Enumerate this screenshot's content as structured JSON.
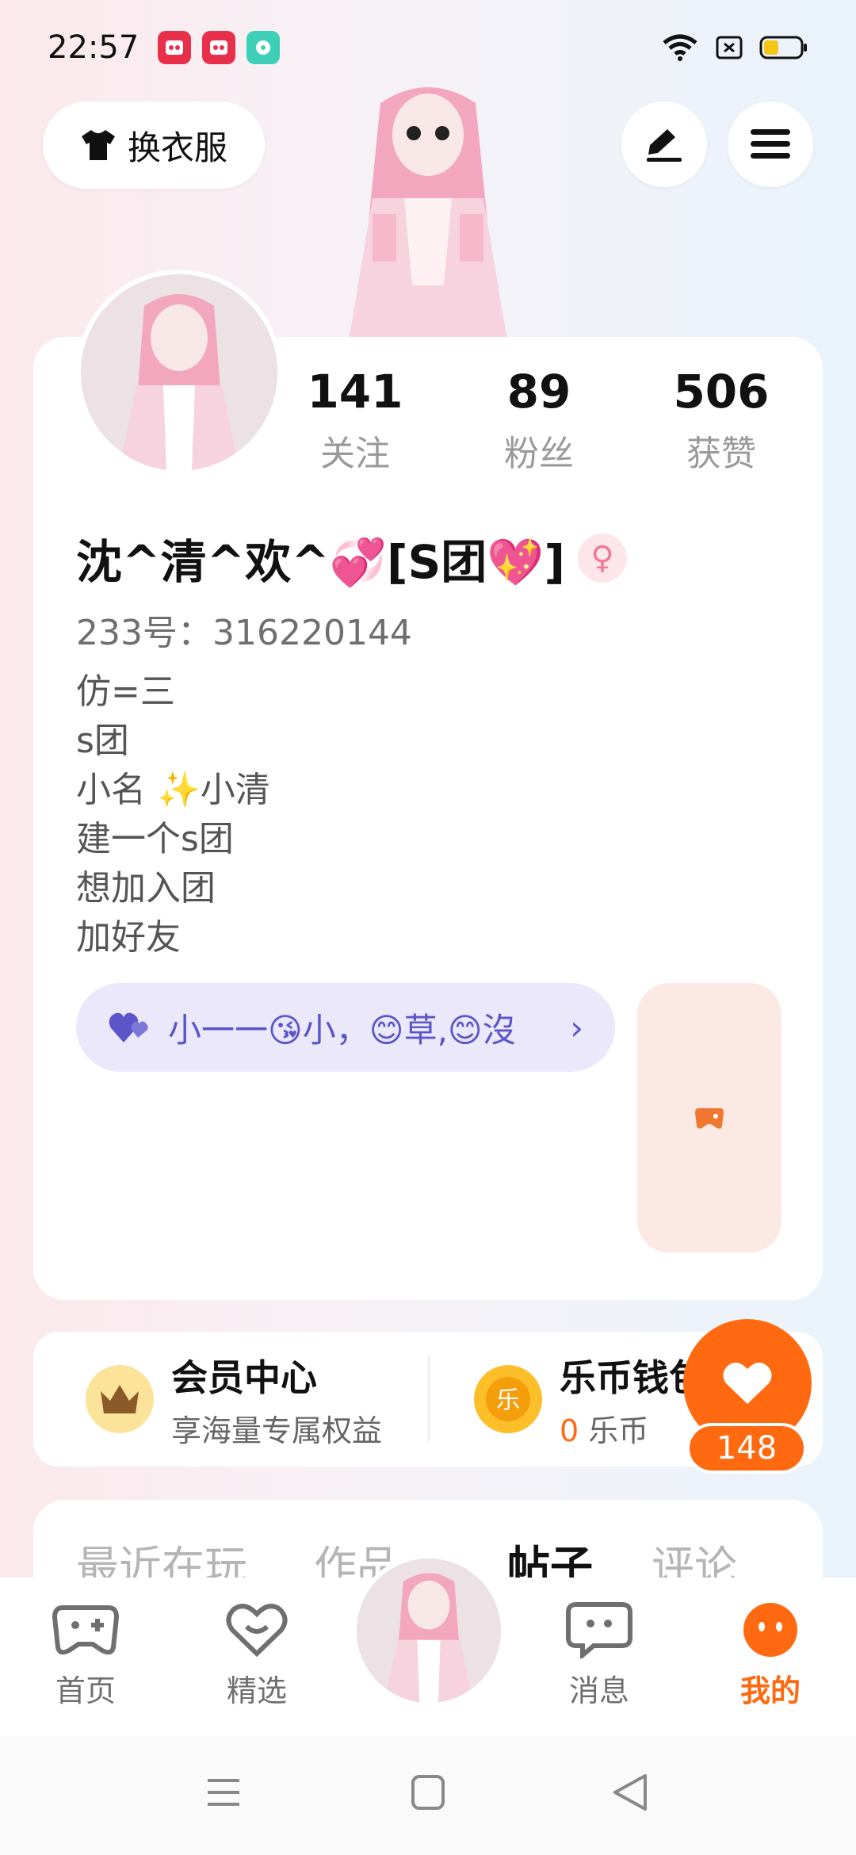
{
  "status_bar": {
    "time": "22:57"
  },
  "header": {
    "dress_label": "换衣服"
  },
  "stats": [
    {
      "value": "141",
      "label": "关注"
    },
    {
      "value": "89",
      "label": "粉丝"
    },
    {
      "value": "506",
      "label": "获赞"
    }
  ],
  "profile": {
    "username": "沈^清^欢^💞[S团💖]",
    "gender_symbol": "♀",
    "user_id": "233号：316220144",
    "bio": [
      "仿=三",
      "s团",
      "小名 ✨小清",
      "建一个s团",
      "想加入团",
      "加好友"
    ]
  },
  "tag_pill": {
    "text": "小一一😘小，😊草,😊沒"
  },
  "vip": {
    "member_title": "会员中心",
    "member_sub": "享海量专属权益",
    "wallet_title": "乐币钱包",
    "wallet_amount": "0",
    "wallet_unit": " 乐币"
  },
  "floating_like": {
    "count": "148"
  },
  "tabs": [
    "最近在玩",
    "作品",
    "帖子",
    "评论"
  ],
  "bottom_nav": [
    {
      "label": "首页"
    },
    {
      "label": "精选"
    },
    {
      "label": "消息"
    },
    {
      "label": "我的"
    }
  ],
  "colors": {
    "accent": "#ff6a10",
    "pill_text": "#5b55c9",
    "pill_bg": "#ebe8fb"
  }
}
